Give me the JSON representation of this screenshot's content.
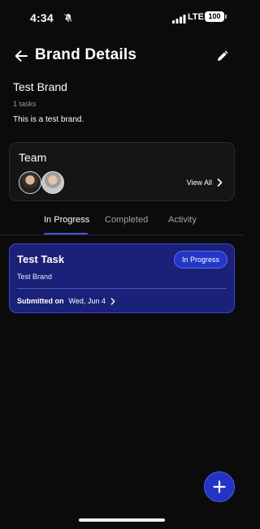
{
  "status_bar": {
    "time": "4:34",
    "network": "LTE",
    "battery": "100"
  },
  "header": {
    "title": "Brand Details",
    "back_icon": "arrow-left-icon",
    "edit_icon": "pencil-icon"
  },
  "brand": {
    "name": "Test Brand",
    "task_count": "1 tasks",
    "description": "This is a test brand."
  },
  "team": {
    "title": "Team",
    "view_all_label": "View All"
  },
  "tabs": [
    {
      "label": "In Progress",
      "active": true
    },
    {
      "label": "Completed",
      "active": false
    },
    {
      "label": "Activity",
      "active": false
    }
  ],
  "tasks": [
    {
      "title": "Test Task",
      "brand": "Test Brand",
      "status": "In Progress",
      "submitted_label": "Submitted on",
      "submitted_date": "Wed, Jun 4"
    }
  ],
  "colors": {
    "background": "#0b0b0c",
    "accent": "#3f58e8",
    "task_card": "#1b2178",
    "fab": "#2334c4"
  }
}
